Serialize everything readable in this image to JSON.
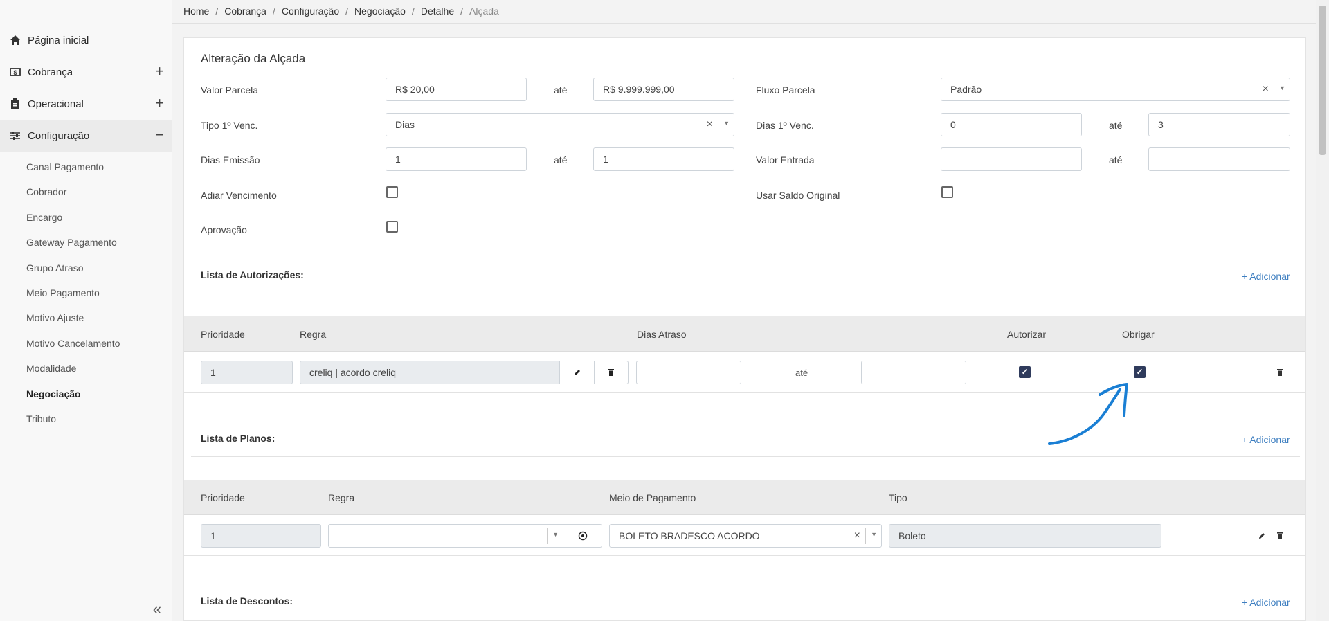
{
  "sidebar": {
    "items": [
      {
        "label": "Página inicial",
        "icon": "home-icon",
        "toggle": ""
      },
      {
        "label": "Cobrança",
        "icon": "dollar-icon",
        "toggle": "+"
      },
      {
        "label": "Operacional",
        "icon": "clipboard-icon",
        "toggle": "+"
      },
      {
        "label": "Configuração",
        "icon": "sliders-icon",
        "toggle": "−"
      }
    ],
    "subitems": [
      "Canal Pagamento",
      "Cobrador",
      "Encargo",
      "Gateway Pagamento",
      "Grupo Atraso",
      "Meio Pagamento",
      "Motivo Ajuste",
      "Motivo Cancelamento",
      "Modalidade",
      "Negociação",
      "Tributo"
    ],
    "active_subitem": "Negociação",
    "collapse_label": "«"
  },
  "breadcrumb": [
    "Home",
    "Cobrança",
    "Configuração",
    "Negociação",
    "Detalhe",
    "Alçada"
  ],
  "form": {
    "title": "Alteração da Alçada",
    "ate": "até",
    "valor_parcela": {
      "label": "Valor Parcela",
      "from": "R$ 20,00",
      "to": "R$ 9.999.999,00"
    },
    "fluxo_parcela": {
      "label": "Fluxo Parcela",
      "value": "Padrão"
    },
    "tipo_venc": {
      "label": "Tipo 1º Venc.",
      "value": "Dias"
    },
    "dias_venc": {
      "label": "Dias 1º Venc.",
      "from": "0",
      "to": "3"
    },
    "dias_emissao": {
      "label": "Dias Emissão",
      "from": "1",
      "to": "1"
    },
    "valor_entrada": {
      "label": "Valor Entrada",
      "from": "",
      "to": ""
    },
    "adiar_vencimento": {
      "label": "Adiar Vencimento",
      "checked": false
    },
    "usar_saldo_original": {
      "label": "Usar Saldo Original",
      "checked": false
    },
    "aprovacao": {
      "label": "Aprovação",
      "checked": false
    }
  },
  "autorizacoes": {
    "heading": "Lista de Autorizações:",
    "add_label": "+ Adicionar",
    "columns": [
      "Prioridade",
      "Regra",
      "Dias Atraso",
      "Autorizar",
      "Obrigar"
    ],
    "rows": [
      {
        "prioridade": "1",
        "regra": "creliq | acordo creliq",
        "dias_de": "",
        "ate": "até",
        "dias_ate": "",
        "autorizar": true,
        "obrigar": true
      }
    ]
  },
  "planos": {
    "heading": "Lista de Planos:",
    "add_label": "+ Adicionar",
    "columns": [
      "Prioridade",
      "Regra",
      "Meio de Pagamento",
      "Tipo"
    ],
    "rows": [
      {
        "prioridade": "1",
        "regra": "",
        "meio_pagamento": "BOLETO BRADESCO ACORDO",
        "tipo": "Boleto"
      }
    ]
  },
  "descontos": {
    "heading": "Lista de Descontos:",
    "add_label": "+ Adicionar"
  },
  "colors": {
    "accent_link": "#3d7ec0",
    "checkbox_checked": "#2f3b5c",
    "annotation_stroke": "#1a7fd4"
  }
}
